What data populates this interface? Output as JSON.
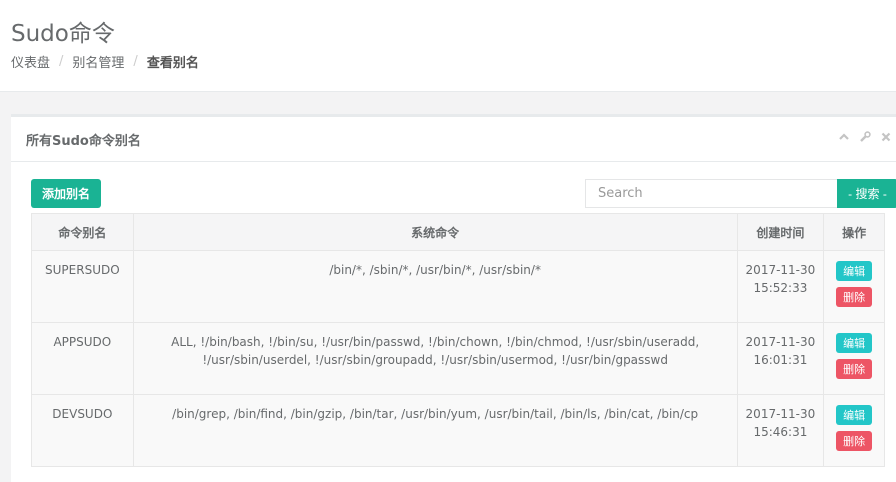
{
  "header": {
    "title": "Sudo命令",
    "breadcrumb": [
      "仪表盘",
      "别名管理",
      "查看别名"
    ],
    "breadcrumb_sep": "/"
  },
  "panel": {
    "title": "所有Sudo命令别名",
    "tools": [
      "chevron-up-icon",
      "wrench-icon",
      "close-icon"
    ],
    "add_label": "添加别名",
    "search_placeholder": "Search",
    "search_label": "- 搜索 -"
  },
  "table": {
    "columns": [
      "命令别名",
      "系统命令",
      "创建时间",
      "操作"
    ],
    "edit_label": "编辑",
    "delete_label": "删除",
    "rows": [
      {
        "alias": "SUPERSUDO",
        "cmd_line1": "/bin/*, /sbin/*, /usr/bin/*, /usr/sbin/*",
        "cmd_line2": "",
        "date": "2017-11-30",
        "time": "15:52:33"
      },
      {
        "alias": "APPSUDO",
        "cmd_line1": "ALL, !/bin/bash, !/bin/su, !/usr/bin/passwd, !/bin/chown, !/bin/chmod, !/usr/sbin/useradd,",
        "cmd_line2": "!/usr/sbin/userdel, !/usr/sbin/groupadd, !/usr/sbin/usermod, !/usr/bin/gpasswd",
        "date": "2017-11-30",
        "time": "16:01:31"
      },
      {
        "alias": "DEVSUDO",
        "cmd_line1": "/bin/grep, /bin/find, /bin/gzip, /bin/tar, /usr/bin/yum, /usr/bin/tail, /bin/ls, /bin/cat, /bin/cp",
        "cmd_line2": "",
        "date": "2017-11-30",
        "time": "15:46:31"
      }
    ]
  },
  "colors": {
    "primary": "#1ab394",
    "info": "#23c6c8",
    "danger": "#ed5565"
  }
}
